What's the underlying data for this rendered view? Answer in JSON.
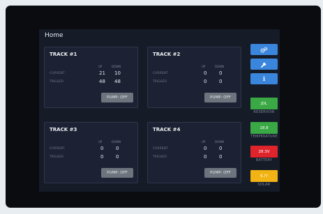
{
  "header": {
    "title": "Home"
  },
  "tracks": [
    {
      "title": "TRACK #1",
      "col_up": "UP",
      "col_down": "DOWN",
      "current_label": "CURRENT",
      "trigger_label": "TRIGGER",
      "current_up": "21",
      "current_down": "10",
      "trigger_up": "48",
      "trigger_down": "48",
      "pump_label": "PUMP: OFF"
    },
    {
      "title": "TRACK #2",
      "col_up": "UP",
      "col_down": "DOWN",
      "current_label": "CURRENT",
      "trigger_label": "TRIGGER",
      "current_up": "0",
      "current_down": "0",
      "trigger_up": "0",
      "trigger_down": "0",
      "pump_label": "PUMP: OFF"
    },
    {
      "title": "TRACK #3",
      "col_up": "UP",
      "col_down": "DOWN",
      "current_label": "CURRENT",
      "trigger_label": "TRIGGER",
      "current_up": "0",
      "current_down": "0",
      "trigger_up": "0",
      "trigger_down": "0",
      "pump_label": "PUMP: OFF"
    },
    {
      "title": "TRACK #4",
      "col_up": "UP",
      "col_down": "DOWN",
      "current_label": "CURRENT",
      "trigger_label": "TRIGGER",
      "current_up": "0",
      "current_down": "0",
      "trigger_up": "0",
      "trigger_down": "0",
      "pump_label": "PUMP: OFF"
    }
  ],
  "sidebar": {
    "buttons": [
      {
        "icon": "gears-icon"
      },
      {
        "icon": "wrench-icon"
      },
      {
        "icon": "info-icon",
        "glyph": "i"
      }
    ],
    "status": [
      {
        "value": "JDL",
        "label": "RESERVOIR",
        "color": "#39a845"
      },
      {
        "value": "18.8",
        "label": "TEMPERATURE",
        "color": "#39a845"
      },
      {
        "value": "28.3V",
        "label": "BATTERY",
        "color": "#e0242c"
      },
      {
        "value": "5.??",
        "label": "SOLAR",
        "color": "#f2b414"
      }
    ]
  },
  "colors": {
    "accent": "#3a86dc",
    "panel": "#1c2233",
    "screen": "#161b28",
    "pump_off": "#6e747d"
  }
}
